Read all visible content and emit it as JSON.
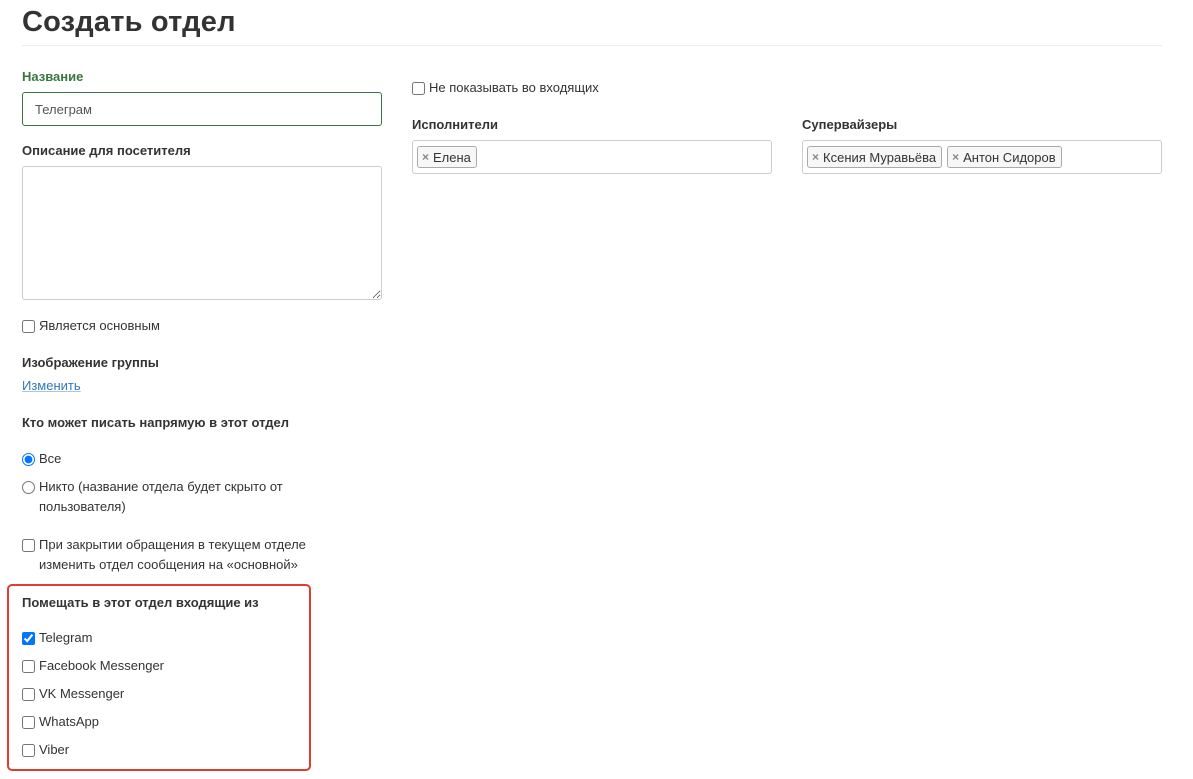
{
  "page": {
    "title": "Создать отдел"
  },
  "form": {
    "name_label": "Название",
    "name_value": "Телеграм",
    "description_label": "Описание для посетителя",
    "description_value": "",
    "is_main_label": "Является основным",
    "image_label": "Изображение группы",
    "image_change_link": "Изменить",
    "who_can_write_label": "Кто может писать напрямую в этот отдел",
    "who_options": [
      {
        "label": "Все",
        "checked": true
      },
      {
        "label": "Никто (название отдела будет скрыто от пользователя)",
        "checked": false
      }
    ],
    "on_close_label": "При закрытии обращения в текущем отделе изменить отдел сообщения на «основной»",
    "incoming_from_label": "Помещать в этот отдел входящие из",
    "channels": [
      {
        "label": "Telegram",
        "checked": true
      },
      {
        "label": "Facebook Messenger",
        "checked": false
      },
      {
        "label": "VK Messenger",
        "checked": false
      },
      {
        "label": "WhatsApp",
        "checked": false
      },
      {
        "label": "Viber",
        "checked": false
      }
    ],
    "hide_in_inbox_label": "Не показывать во входящих",
    "executors_label": "Исполнители",
    "executors": [
      "Елена"
    ],
    "supervisors_label": "Супервайзеры",
    "supervisors": [
      "Ксения Муравьёва",
      "Антон Сидоров"
    ],
    "remove_icon": "×"
  },
  "colors": {
    "accent_green": "#3c763d",
    "link_blue": "#337ab7",
    "highlight_red": "#e03c31"
  }
}
